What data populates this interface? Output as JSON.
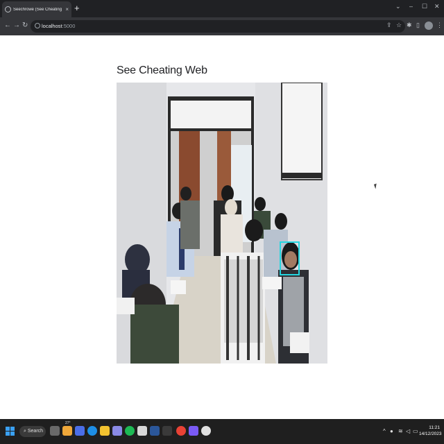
{
  "browser": {
    "tab_title": "Seechrowe (See Cheating Web)",
    "url_host": "localhost",
    "url_port": ":5000",
    "new_tab_symbol": "+",
    "tab_close_symbol": "×",
    "window_controls": [
      "⌄",
      "–",
      "☐",
      "✕"
    ],
    "nav_back": "←",
    "nav_forward": "→",
    "nav_reload": "↻"
  },
  "page": {
    "heading": "See Cheating Web",
    "video_feed_description_icon": "camera-feed"
  },
  "taskbar": {
    "search_label": "Search",
    "clock_time": "11:21",
    "clock_date": "14/12/2023",
    "weather_temp": "27°"
  }
}
